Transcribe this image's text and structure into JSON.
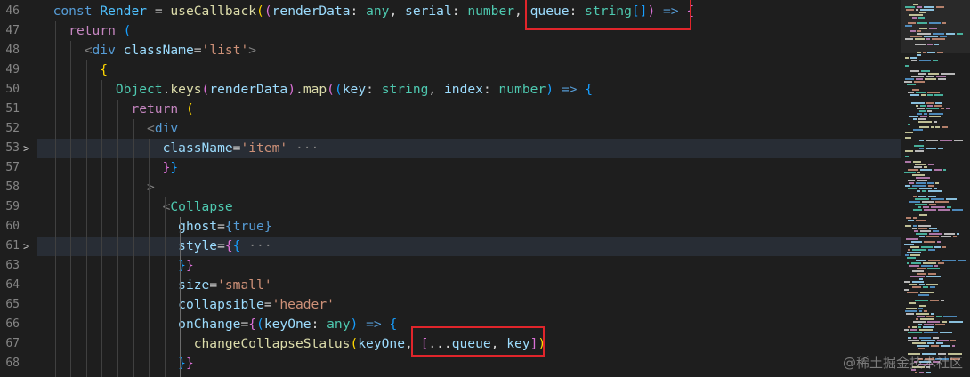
{
  "editor": {
    "lines": [
      {
        "num": "46",
        "fold": "",
        "hl": false,
        "indent": 0,
        "tokens": [
          {
            "t": "  ",
            "c": "op"
          },
          {
            "t": "const",
            "c": "decl"
          },
          {
            "t": " ",
            "c": "op"
          },
          {
            "t": "Render",
            "c": "cls"
          },
          {
            "t": " = ",
            "c": "op"
          },
          {
            "t": "useCallback",
            "c": "fn"
          },
          {
            "t": "(",
            "c": "b1"
          },
          {
            "t": "(",
            "c": "b2"
          },
          {
            "t": "renderData",
            "c": "var"
          },
          {
            "t": ": ",
            "c": "op"
          },
          {
            "t": "any",
            "c": "type"
          },
          {
            "t": ", ",
            "c": "op"
          },
          {
            "t": "serial",
            "c": "var"
          },
          {
            "t": ": ",
            "c": "op"
          },
          {
            "t": "number",
            "c": "type"
          },
          {
            "t": ", ",
            "c": "op"
          },
          {
            "t": "queue",
            "c": "var"
          },
          {
            "t": ": ",
            "c": "op"
          },
          {
            "t": "string",
            "c": "type"
          },
          {
            "t": "[]",
            "c": "b3"
          },
          {
            "t": ")",
            "c": "b2"
          },
          {
            "t": " => ",
            "c": "decl"
          },
          {
            "t": "{",
            "c": "b2"
          }
        ]
      },
      {
        "num": "47",
        "fold": "",
        "hl": false,
        "tokens": [
          {
            "t": "    ",
            "c": "op"
          },
          {
            "t": "return",
            "c": "kw"
          },
          {
            "t": " ",
            "c": "op"
          },
          {
            "t": "(",
            "c": "b3"
          }
        ]
      },
      {
        "num": "48",
        "fold": "",
        "hl": false,
        "tokens": [
          {
            "t": "      ",
            "c": "op"
          },
          {
            "t": "<",
            "c": "ang"
          },
          {
            "t": "div",
            "c": "tag"
          },
          {
            "t": " ",
            "c": "op"
          },
          {
            "t": "className",
            "c": "attr"
          },
          {
            "t": "=",
            "c": "op"
          },
          {
            "t": "'list'",
            "c": "str"
          },
          {
            "t": ">",
            "c": "ang"
          }
        ]
      },
      {
        "num": "49",
        "fold": "",
        "hl": false,
        "tokens": [
          {
            "t": "        ",
            "c": "op"
          },
          {
            "t": "{",
            "c": "b1"
          }
        ]
      },
      {
        "num": "50",
        "fold": "",
        "hl": false,
        "tokens": [
          {
            "t": "          ",
            "c": "op"
          },
          {
            "t": "Object",
            "c": "type"
          },
          {
            "t": ".",
            "c": "op"
          },
          {
            "t": "keys",
            "c": "fn"
          },
          {
            "t": "(",
            "c": "b2"
          },
          {
            "t": "renderData",
            "c": "var"
          },
          {
            "t": ")",
            "c": "b2"
          },
          {
            "t": ".",
            "c": "op"
          },
          {
            "t": "map",
            "c": "fn"
          },
          {
            "t": "(",
            "c": "b2"
          },
          {
            "t": "(",
            "c": "b3"
          },
          {
            "t": "key",
            "c": "var"
          },
          {
            "t": ": ",
            "c": "op"
          },
          {
            "t": "string",
            "c": "type"
          },
          {
            "t": ", ",
            "c": "op"
          },
          {
            "t": "index",
            "c": "var"
          },
          {
            "t": ": ",
            "c": "op"
          },
          {
            "t": "number",
            "c": "type"
          },
          {
            "t": ")",
            "c": "b3"
          },
          {
            "t": " => ",
            "c": "decl"
          },
          {
            "t": "{",
            "c": "b3"
          }
        ]
      },
      {
        "num": "51",
        "fold": "",
        "hl": false,
        "tokens": [
          {
            "t": "            ",
            "c": "op"
          },
          {
            "t": "return",
            "c": "kw"
          },
          {
            "t": " ",
            "c": "op"
          },
          {
            "t": "(",
            "c": "b1"
          }
        ]
      },
      {
        "num": "52",
        "fold": "",
        "hl": false,
        "tokens": [
          {
            "t": "              ",
            "c": "op"
          },
          {
            "t": "<",
            "c": "ang"
          },
          {
            "t": "div",
            "c": "tag"
          }
        ]
      },
      {
        "num": "53",
        "fold": ">",
        "hl": true,
        "tokens": [
          {
            "t": "                ",
            "c": "op"
          },
          {
            "t": "className",
            "c": "attr"
          },
          {
            "t": "=",
            "c": "op"
          },
          {
            "t": "'item'",
            "c": "str"
          },
          {
            "t": " ···",
            "c": "cmt"
          }
        ]
      },
      {
        "num": "57",
        "fold": "",
        "hl": false,
        "tokens": [
          {
            "t": "                ",
            "c": "op"
          },
          {
            "t": "}",
            "c": "b2"
          },
          {
            "t": "}",
            "c": "b3"
          }
        ]
      },
      {
        "num": "58",
        "fold": "",
        "hl": false,
        "tokens": [
          {
            "t": "              ",
            "c": "op"
          },
          {
            "t": ">",
            "c": "ang"
          }
        ]
      },
      {
        "num": "59",
        "fold": "",
        "hl": false,
        "tokens": [
          {
            "t": "                ",
            "c": "op"
          },
          {
            "t": "<",
            "c": "ang"
          },
          {
            "t": "Collapse",
            "c": "type"
          }
        ]
      },
      {
        "num": "60",
        "fold": "",
        "hl": false,
        "tokens": [
          {
            "t": "                  ",
            "c": "op"
          },
          {
            "t": "ghost",
            "c": "attr"
          },
          {
            "t": "=",
            "c": "op"
          },
          {
            "t": "{",
            "c": "decl"
          },
          {
            "t": "true",
            "c": "bool"
          },
          {
            "t": "}",
            "c": "decl"
          }
        ]
      },
      {
        "num": "61",
        "fold": ">",
        "hl": true,
        "tokens": [
          {
            "t": "                  ",
            "c": "op"
          },
          {
            "t": "style",
            "c": "attr"
          },
          {
            "t": "=",
            "c": "op"
          },
          {
            "t": "{",
            "c": "b2"
          },
          {
            "t": "{",
            "c": "b3"
          },
          {
            "t": " ···",
            "c": "cmt"
          }
        ]
      },
      {
        "num": "63",
        "fold": "",
        "hl": false,
        "tokens": [
          {
            "t": "                  ",
            "c": "op"
          },
          {
            "t": "}",
            "c": "b3"
          },
          {
            "t": "}",
            "c": "b2"
          }
        ]
      },
      {
        "num": "64",
        "fold": "",
        "hl": false,
        "tokens": [
          {
            "t": "                  ",
            "c": "op"
          },
          {
            "t": "size",
            "c": "attr"
          },
          {
            "t": "=",
            "c": "op"
          },
          {
            "t": "'small'",
            "c": "str"
          }
        ]
      },
      {
        "num": "65",
        "fold": "",
        "hl": false,
        "tokens": [
          {
            "t": "                  ",
            "c": "op"
          },
          {
            "t": "collapsible",
            "c": "attr"
          },
          {
            "t": "=",
            "c": "op"
          },
          {
            "t": "'header'",
            "c": "str"
          }
        ]
      },
      {
        "num": "66",
        "fold": "",
        "hl": false,
        "tokens": [
          {
            "t": "                  ",
            "c": "op"
          },
          {
            "t": "onChange",
            "c": "attr"
          },
          {
            "t": "=",
            "c": "op"
          },
          {
            "t": "{",
            "c": "b2"
          },
          {
            "t": "(",
            "c": "b3"
          },
          {
            "t": "keyOne",
            "c": "var"
          },
          {
            "t": ": ",
            "c": "op"
          },
          {
            "t": "any",
            "c": "type"
          },
          {
            "t": ")",
            "c": "b3"
          },
          {
            "t": " => ",
            "c": "decl"
          },
          {
            "t": "{",
            "c": "b3"
          }
        ]
      },
      {
        "num": "67",
        "fold": "",
        "hl": false,
        "tokens": [
          {
            "t": "                    ",
            "c": "op"
          },
          {
            "t": "changeCollapseStatus",
            "c": "fn"
          },
          {
            "t": "(",
            "c": "b1"
          },
          {
            "t": "keyOne",
            "c": "var"
          },
          {
            "t": ", ",
            "c": "op"
          },
          {
            "t": "[",
            "c": "b2"
          },
          {
            "t": "...",
            "c": "op"
          },
          {
            "t": "queue",
            "c": "var"
          },
          {
            "t": ", ",
            "c": "op"
          },
          {
            "t": "key",
            "c": "var"
          },
          {
            "t": "]",
            "c": "b2"
          },
          {
            "t": ")",
            "c": "b1"
          }
        ]
      },
      {
        "num": "68",
        "fold": "",
        "hl": false,
        "tokens": [
          {
            "t": "                  ",
            "c": "op"
          },
          {
            "t": "}",
            "c": "b3"
          },
          {
            "t": "}",
            "c": "b2"
          }
        ]
      }
    ]
  },
  "watermark": "@稀土掘金技术社区"
}
